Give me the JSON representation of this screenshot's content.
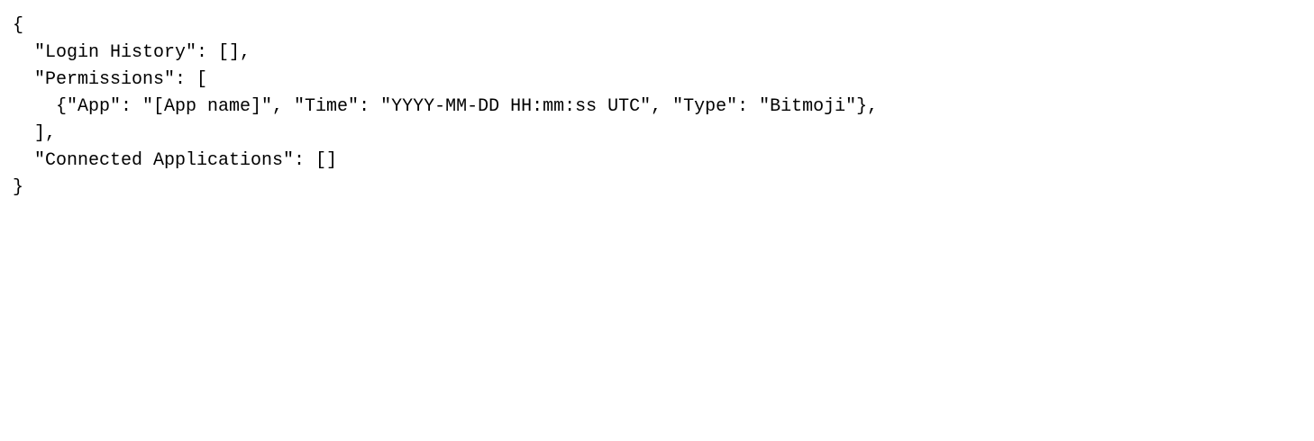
{
  "document": {
    "lines": [
      "{",
      "  \"Login History\": [],",
      "  \"Permissions\": [",
      "    {\"App\": \"[App name]\", \"Time\": \"YYYY-MM-DD HH:mm:ss UTC\", \"Type\": \"Bitmoji\"},",
      "  ],",
      "  \"Connected Applications\": []",
      "}"
    ]
  }
}
